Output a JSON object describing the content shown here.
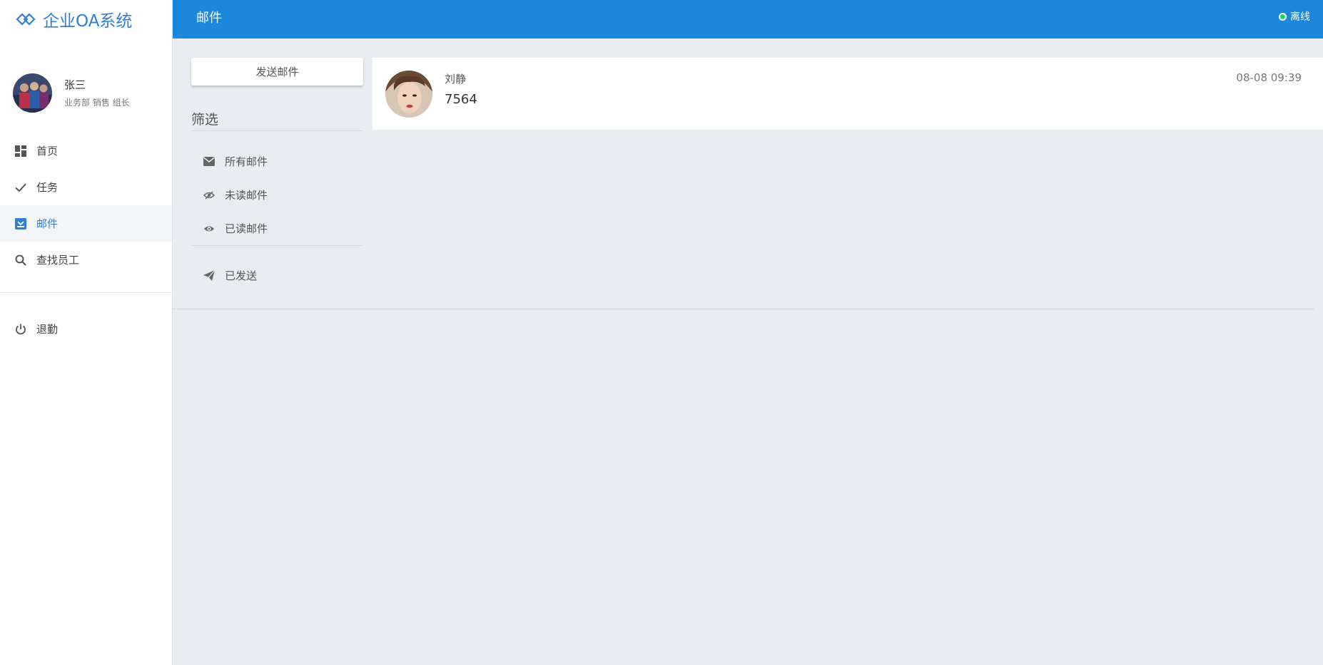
{
  "app": {
    "title": "企业OA系统"
  },
  "user": {
    "name": "张三",
    "dept": "业务部 销售 组长"
  },
  "nav": {
    "items": [
      {
        "label": "首页",
        "icon": "dashboard-icon"
      },
      {
        "label": "任务",
        "icon": "check-icon"
      },
      {
        "label": "邮件",
        "icon": "inbox-icon",
        "active": true
      },
      {
        "label": "查找员工",
        "icon": "search-icon"
      }
    ],
    "logout": {
      "label": "退勤",
      "icon": "power-icon"
    }
  },
  "topbar": {
    "title": "邮件",
    "status": "离线",
    "status_color": "#2ecc71",
    "bg_color": "#1b88e0"
  },
  "mail_panel": {
    "send_button": "发送邮件",
    "filter_title": "筛选",
    "filters": [
      {
        "label": "所有邮件",
        "icon": "envelope-icon"
      },
      {
        "label": "未读邮件",
        "icon": "eye-slash-icon"
      },
      {
        "label": "已读邮件",
        "icon": "eye-icon"
      }
    ],
    "sent": {
      "label": "已发送",
      "icon": "paper-plane-icon"
    }
  },
  "mails": [
    {
      "sender": "刘静",
      "subject": "7564",
      "time": "08-08 09:39"
    }
  ]
}
